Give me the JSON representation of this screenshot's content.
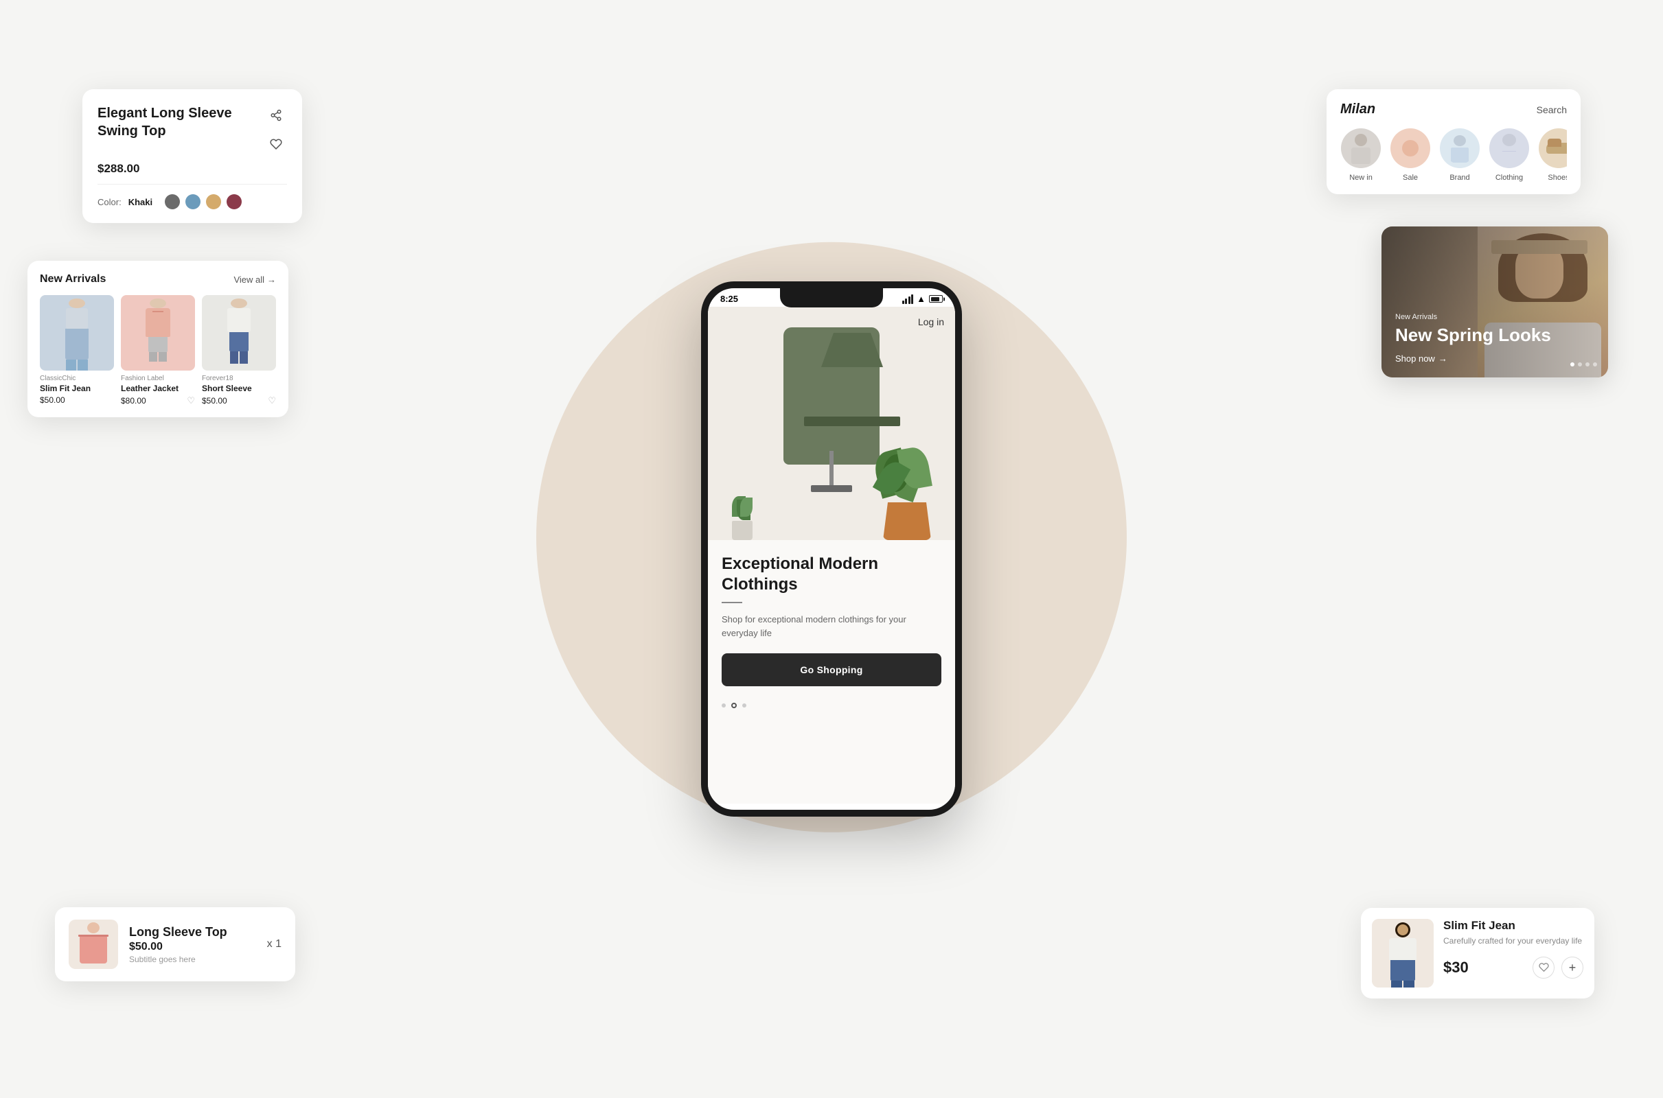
{
  "phone": {
    "status_time": "8:25",
    "log_in": "Log in",
    "hero_headline": "Exceptional Modern Clothings",
    "hero_subtitle": "Shop for exceptional modern clothings for your everyday life",
    "cta_label": "Go Shopping",
    "dots": [
      "inactive",
      "active",
      "inactive"
    ]
  },
  "product_detail_card": {
    "title": "Elegant Long Sleeve Swing Top",
    "price": "$288.00",
    "color_label": "Color:",
    "color_name": "Khaki",
    "swatches": [
      {
        "color": "#6b6b6b",
        "name": "charcoal"
      },
      {
        "color": "#6b9bbb",
        "name": "blue"
      },
      {
        "color": "#d4aa6b",
        "name": "tan"
      },
      {
        "color": "#8b3a4a",
        "name": "burgundy"
      }
    ]
  },
  "new_arrivals_card": {
    "title": "New Arrivals",
    "view_all": "View all",
    "items": [
      {
        "brand": "ClassicChic",
        "name": "Slim Fit Jean",
        "price": "$50.00",
        "bg": "#c8d4e0"
      },
      {
        "brand": "Fashion Label",
        "name": "Leather Jacket",
        "price": "$80.00",
        "bg": "#f0c8c0"
      },
      {
        "brand": "Forever18",
        "name": "Short Sleeve",
        "price": "$50.00",
        "bg": "#e0e0e0"
      }
    ]
  },
  "cart_card": {
    "name": "Long Sleeve Top",
    "price": "$50.00",
    "subtitle": "Subtitle goes here",
    "quantity": "x 1"
  },
  "nav_card": {
    "brand": "Milan",
    "search": "Search",
    "categories": [
      {
        "label": "New in",
        "bg": "#d0ccc8"
      },
      {
        "label": "Sale",
        "bg": "#e8c4b8"
      },
      {
        "label": "Brand",
        "bg": "#c8d4e0"
      },
      {
        "label": "Clothing",
        "bg": "#d0d8e8"
      },
      {
        "label": "Shoes",
        "bg": "#d4c4a8"
      }
    ]
  },
  "banner_card": {
    "tag": "New Arrivals",
    "title": "New Spring Looks",
    "cta": "Shop now"
  },
  "product_card": {
    "name": "Slim Fit Jean",
    "desc": "Carefully crafted for your everyday life",
    "price": "$30"
  }
}
